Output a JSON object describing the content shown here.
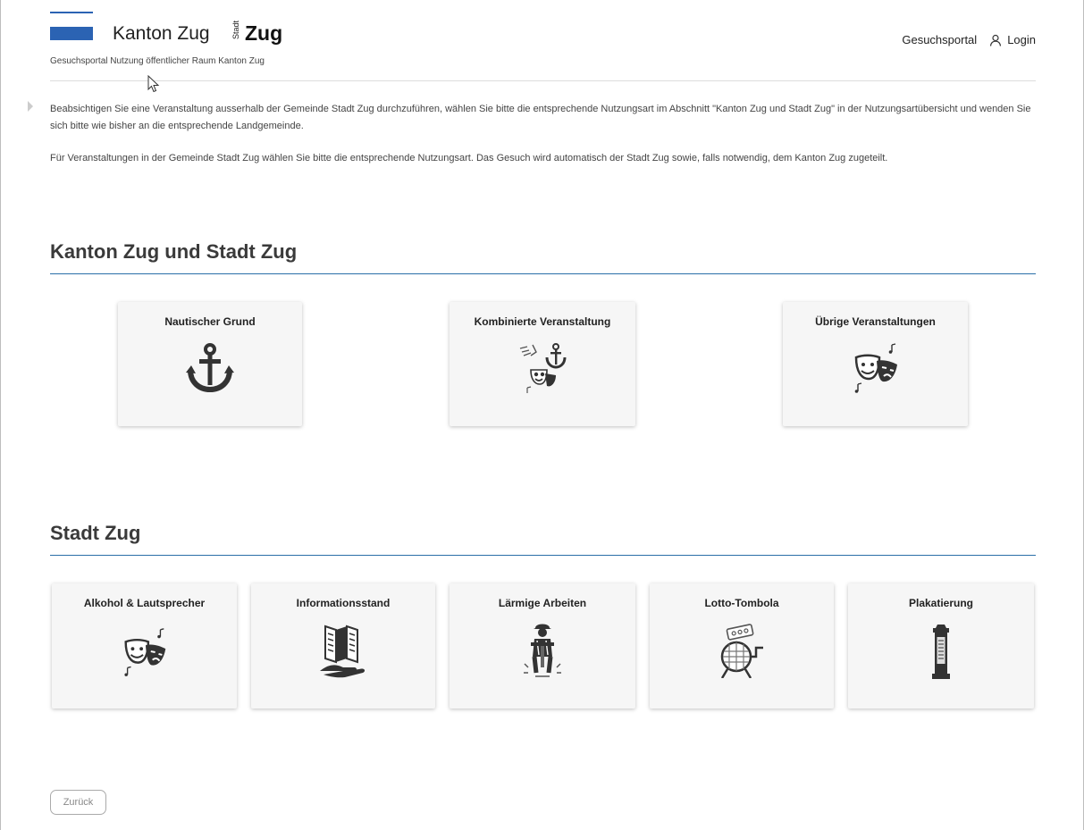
{
  "header": {
    "logo_kanton": "Kanton Zug",
    "logo_stadt": "Stadt",
    "logo_zug": "Zug",
    "subtitle": "Gesuchsportal Nutzung öffentlicher Raum Kanton Zug",
    "nav_portal": "Gesuchsportal",
    "nav_login": "Login",
    "brand_color": "#2b63b3"
  },
  "intro": {
    "p1": "Beabsichtigen Sie eine Veranstaltung ausserhalb der Gemeinde Stadt Zug durchzuführen, wählen Sie bitte die entsprechende Nutzungsart im Abschnitt \"Kanton Zug und Stadt Zug\" in der Nutzungsartübersicht und wenden Sie sich bitte wie bisher an die entsprechende Landgemeinde.",
    "p2": "Für Veranstaltungen in der Gemeinde Stadt Zug wählen Sie bitte die entsprechende Nutzungsart. Das Gesuch wird automatisch der Stadt Zug sowie, falls notwendig, dem Kanton Zug zugeteilt."
  },
  "section1": {
    "title": "Kanton Zug und Stadt Zug",
    "cards": [
      {
        "label": "Nautischer Grund",
        "icon": "anchor-icon"
      },
      {
        "label": "Kombinierte Veranstaltung",
        "icon": "combined-event-icon"
      },
      {
        "label": "Übrige Veranstaltungen",
        "icon": "theater-masks-icon"
      }
    ]
  },
  "section2": {
    "title": "Stadt Zug",
    "cards": [
      {
        "label": "Alkohol & Lautsprecher",
        "icon": "theater-masks-icon"
      },
      {
        "label": "Informationsstand",
        "icon": "brochure-hand-icon"
      },
      {
        "label": "Lärmige Arbeiten",
        "icon": "jackhammer-worker-icon"
      },
      {
        "label": "Lotto-Tombola",
        "icon": "lottery-drum-icon"
      },
      {
        "label": "Plakatierung",
        "icon": "advertising-column-icon"
      }
    ]
  },
  "footer": {
    "back_label": "Zurück"
  },
  "colors": {
    "section_rule": "#2a6fa8",
    "card_bg": "#f6f6f6"
  }
}
